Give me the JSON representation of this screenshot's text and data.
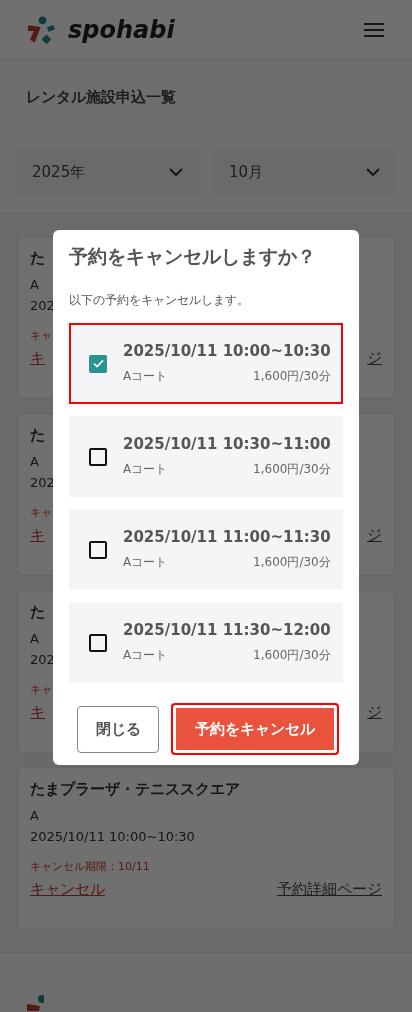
{
  "header": {
    "logo_text": "spohabi"
  },
  "page_title": "レンタル施設申込一覧",
  "filters": [
    {
      "value": "2025年"
    },
    {
      "value": "10月"
    }
  ],
  "cards": [
    {
      "title": "た",
      "court": "A",
      "datetime": "202",
      "deadline": "キャ",
      "cancel_link": "キ",
      "detail_link": "ジ"
    },
    {
      "title": "た",
      "court": "A",
      "datetime": "202",
      "deadline": "キャ",
      "cancel_link": "キ",
      "detail_link": "ジ"
    },
    {
      "title": "た",
      "court": "A",
      "datetime": "202",
      "deadline": "キャ",
      "cancel_link": "キ",
      "detail_link": "ジ"
    },
    {
      "title": "たまプラーザ・テニススクエア",
      "court": "A",
      "datetime": "2025/10/11 10:00~10:30",
      "deadline": "キャンセル期限：10/11",
      "cancel_link": "キャンセル",
      "detail_link": "予約詳細ページ"
    }
  ],
  "dialog": {
    "title": "予約をキャンセルしますか？",
    "message": "以下の予約をキャンセルします。",
    "options": [
      {
        "datetime": "2025/10/11 10:00~10:30",
        "court": "Aコート",
        "price": "1,600円/30分",
        "checked": true
      },
      {
        "datetime": "2025/10/11 10:30~11:00",
        "court": "Aコート",
        "price": "1,600円/30分",
        "checked": false
      },
      {
        "datetime": "2025/10/11 11:00~11:30",
        "court": "Aコート",
        "price": "1,600円/30分",
        "checked": false
      },
      {
        "datetime": "2025/10/11 11:30~12:00",
        "court": "Aコート",
        "price": "1,600円/30分",
        "checked": false
      }
    ],
    "buttons": [
      {
        "label": "閉じる",
        "kind": "secondary",
        "highlighted": false
      },
      {
        "label": "予約をキャンセル",
        "kind": "primary",
        "highlighted": true
      }
    ]
  }
}
